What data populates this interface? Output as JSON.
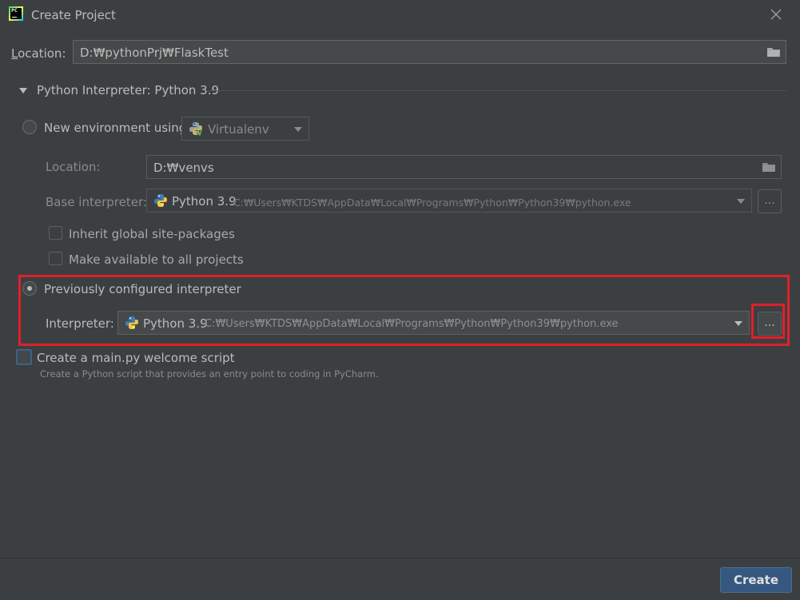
{
  "window": {
    "title": "Create Project",
    "app_icon_text": "PC"
  },
  "location": {
    "label_prefix": "L",
    "label_rest": "ocation:",
    "value": "D:₩pythonPrj₩FlaskTest"
  },
  "interpreter_section": {
    "header": "Python Interpreter: Python 3.9",
    "expanded": true
  },
  "new_env": {
    "label": "New environment using",
    "selected": false,
    "tool": "Virtualenv",
    "location_label": "Location:",
    "location_value": "D:₩venvs",
    "base_label": "Base interpreter:",
    "base_name": "Python 3.9",
    "base_path": "C:₩Users₩KTDS₩AppData₩Local₩Programs₩Python₩Python39₩python.exe",
    "browse_label": "...",
    "inherit_label": "Inherit global site-packages",
    "inherit_checked": false,
    "available_label": "Make available to all projects",
    "available_checked": false
  },
  "previous": {
    "label": "Previously configured interpreter",
    "selected": true,
    "interpreter_label": "Interpreter:",
    "interpreter_name": "Python 3.9",
    "interpreter_path": "C:₩Users₩KTDS₩AppData₩Local₩Programs₩Python₩Python39₩python.exe",
    "browse_label": "..."
  },
  "welcome": {
    "label": "Create a main.py welcome script",
    "checked": false,
    "description": "Create a Python script that provides an entry point to coding in PyCharm."
  },
  "footer": {
    "create_label": "Create"
  },
  "colors": {
    "background": "#3c3f41",
    "highlight": "#e0202a",
    "primary_button": "#365880"
  }
}
